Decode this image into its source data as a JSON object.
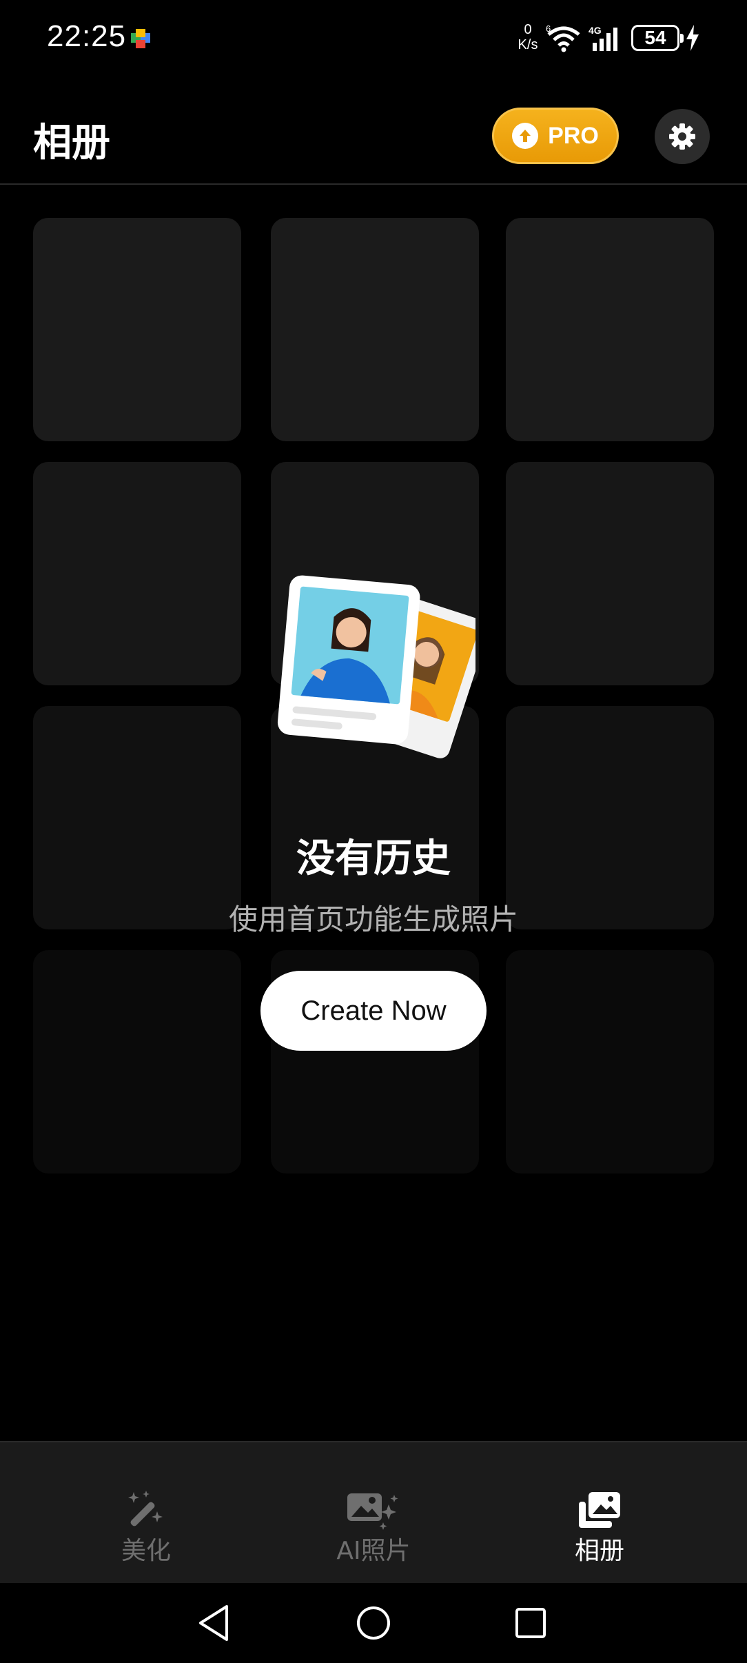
{
  "status_bar": {
    "time": "22:25",
    "net_speed_value": "0",
    "net_speed_unit": "K/s",
    "wifi_label": "6",
    "cell_label": "4G",
    "battery": "54"
  },
  "header": {
    "title": "相册",
    "pro_label": "PRO"
  },
  "empty_state": {
    "title": "没有历史",
    "subtitle": "使用首页功能生成照片",
    "create_button": "Create Now"
  },
  "bottom_nav": {
    "items": [
      {
        "label": "美化",
        "icon": "magic-wand-icon",
        "active": false
      },
      {
        "label": "AI照片",
        "icon": "ai-photo-icon",
        "active": false
      },
      {
        "label": "相册",
        "icon": "album-icon",
        "active": true
      }
    ]
  },
  "colors": {
    "background": "#000000",
    "placeholder": "#1a1a1a",
    "pro_gold": "#f0a510",
    "nav_background": "#1b1b1b"
  }
}
